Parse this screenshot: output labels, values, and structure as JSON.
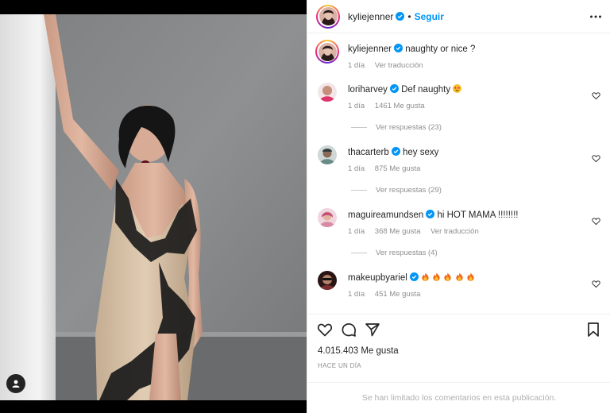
{
  "post": {
    "author": "kyliejenner",
    "separator": "•",
    "follow_label": "Seguir",
    "caption": {
      "username": "kyliejenner",
      "text": "naughty or nice ?",
      "time": "1 día",
      "translate_label": "Ver traducción"
    }
  },
  "comments": [
    {
      "username": "loriharvey",
      "text": "Def naughty",
      "emoji": [
        "star-struck-emoji"
      ],
      "time": "1 día",
      "likes": "1461 Me gusta",
      "replies": "Ver respuestas (23)",
      "avatar_color": "#e0356b"
    },
    {
      "username": "thacarterb",
      "text": "hey sexy",
      "time": "1 día",
      "likes": "875 Me gusta",
      "replies": "Ver respuestas (29)",
      "avatar_color": "#6a8a88"
    },
    {
      "username": "maguireamundsen",
      "text": "hi HOT MAMA !!!!!!!!",
      "time": "1 día",
      "likes": "368 Me gusta",
      "translate_label": "Ver traducción",
      "replies": "Ver respuestas (4)",
      "avatar_color": "#d98aa3"
    },
    {
      "username": "makeupbyariel",
      "text": "",
      "emoji": [
        "fire-emoji",
        "fire-emoji",
        "fire-emoji",
        "fire-emoji",
        "fire-emoji"
      ],
      "time": "1 día",
      "likes": "451 Me gusta",
      "avatar_color": "#7a2e2e"
    }
  ],
  "likes_count": "4.015.403 Me gusta",
  "time_ago": "HACE UN DÍA",
  "footer_text": "Se han limitado los comentarios en esta publicación.",
  "colors": {
    "accent": "#0095f6",
    "verified": "#0095f6",
    "text": "#262626",
    "muted": "#8e8e8e"
  }
}
